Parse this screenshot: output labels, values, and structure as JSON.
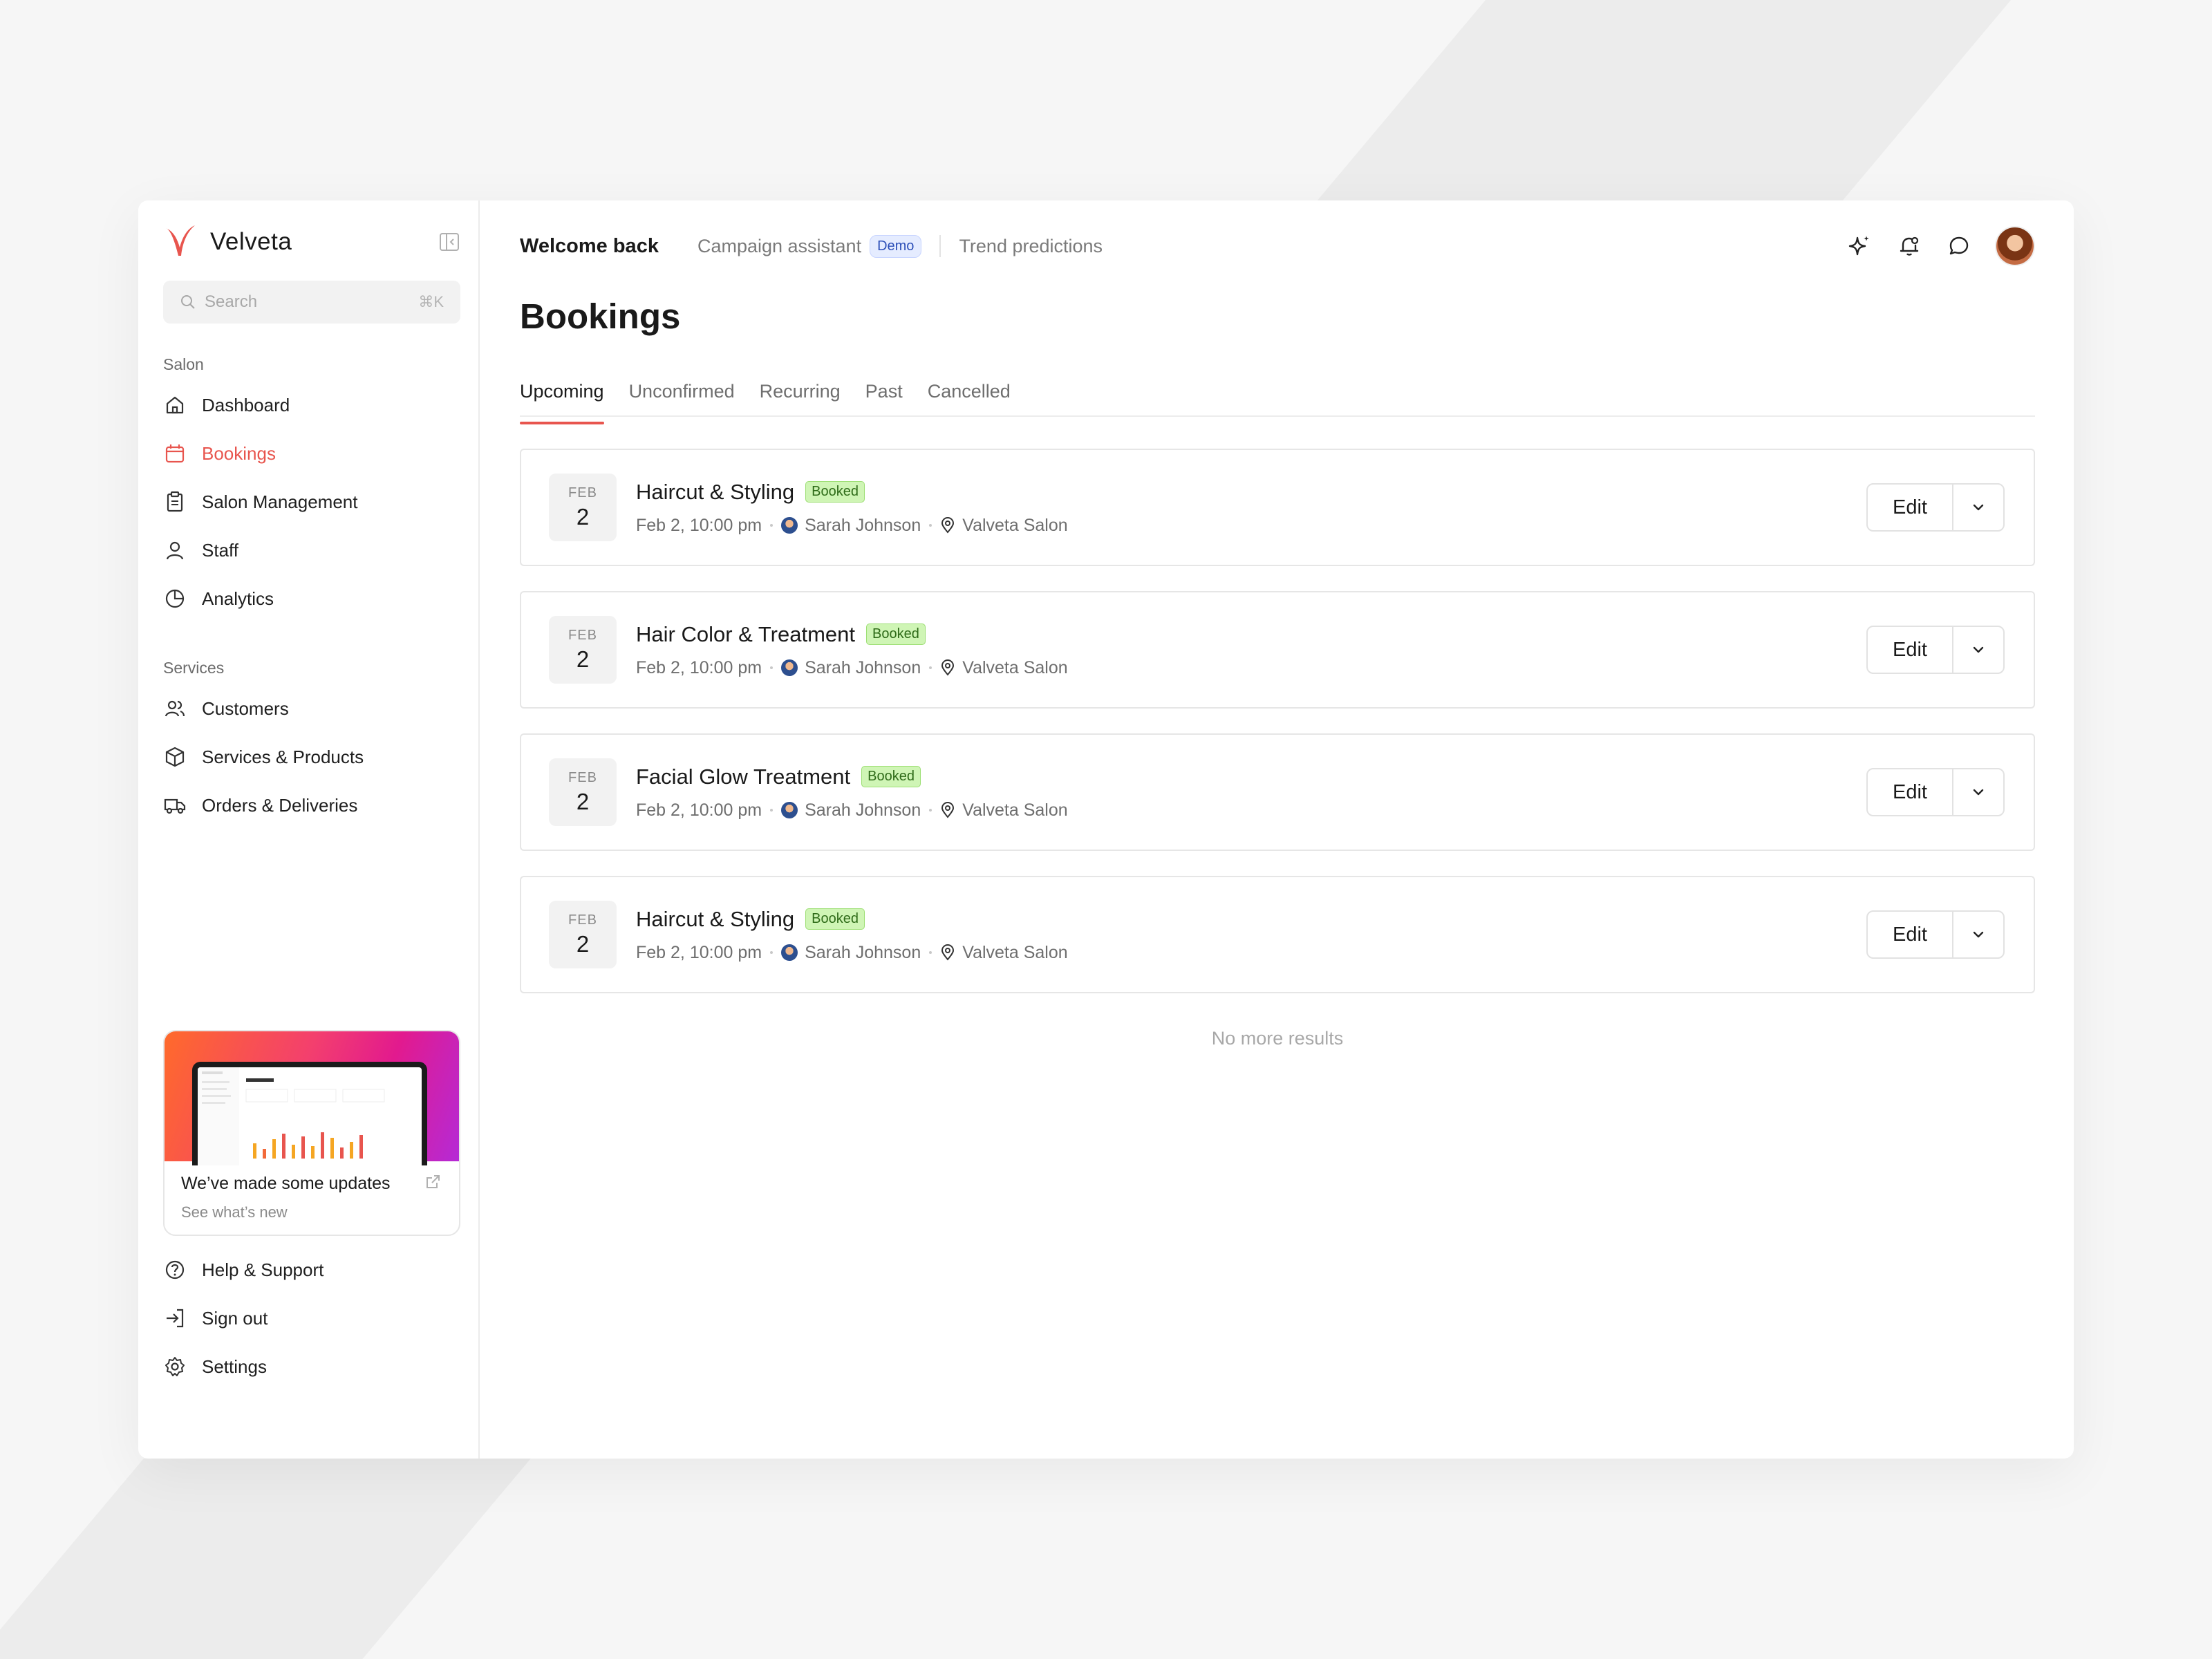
{
  "brand": {
    "name": "Velveta"
  },
  "search": {
    "placeholder": "Search",
    "shortcut": "⌘K"
  },
  "sidebar": {
    "section1_label": "Salon",
    "section1_items": [
      {
        "label": "Dashboard",
        "icon": "home-icon"
      },
      {
        "label": "Bookings",
        "icon": "calendar-icon",
        "active": true
      },
      {
        "label": "Salon Management",
        "icon": "clipboard-icon"
      },
      {
        "label": "Staff",
        "icon": "user-icon"
      },
      {
        "label": "Analytics",
        "icon": "pie-chart-icon"
      }
    ],
    "section2_label": "Services",
    "section2_items": [
      {
        "label": "Customers",
        "icon": "users-icon"
      },
      {
        "label": "Services & Products",
        "icon": "box-icon"
      },
      {
        "label": "Orders & Deliveries",
        "icon": "truck-icon"
      }
    ],
    "update_card": {
      "title": "We’ve made some updates",
      "subtitle": "See what’s new"
    },
    "bottom_items": [
      {
        "label": "Help & Support",
        "icon": "help-icon"
      },
      {
        "label": "Sign out",
        "icon": "sign-out-icon"
      },
      {
        "label": "Settings",
        "icon": "gear-icon"
      }
    ]
  },
  "topbar": {
    "welcome": "Welcome back",
    "campaign": "Campaign assistant",
    "demo_badge": "Demo",
    "trends": "Trend predictions"
  },
  "page": {
    "title": "Bookings",
    "tabs": [
      "Upcoming",
      "Unconfirmed",
      "Recurring",
      "Past",
      "Cancelled"
    ],
    "active_tab": "Upcoming",
    "no_more": "No more results"
  },
  "bookings": [
    {
      "month": "FEB",
      "day": "2",
      "title": "Haircut & Styling",
      "status": "Booked",
      "time": "Feb 2, 10:00 pm",
      "staff": "Sarah Johnson",
      "location": "Valveta Salon",
      "edit": "Edit"
    },
    {
      "month": "FEB",
      "day": "2",
      "title": "Hair Color & Treatment",
      "status": "Booked",
      "time": "Feb 2, 10:00 pm",
      "staff": "Sarah Johnson",
      "location": "Valveta Salon",
      "edit": "Edit"
    },
    {
      "month": "FEB",
      "day": "2",
      "title": "Facial Glow Treatment",
      "status": "Booked",
      "time": "Feb 2, 10:00 pm",
      "staff": "Sarah Johnson",
      "location": "Valveta Salon",
      "edit": "Edit"
    },
    {
      "month": "FEB",
      "day": "2",
      "title": "Haircut & Styling",
      "status": "Booked",
      "time": "Feb 2, 10:00 pm",
      "staff": "Sarah Johnson",
      "location": "Valveta Salon",
      "edit": "Edit"
    }
  ],
  "colors": {
    "accent": "#e8554e",
    "status_bg": "#cff5b5",
    "demo_bg": "#e5ecff"
  }
}
